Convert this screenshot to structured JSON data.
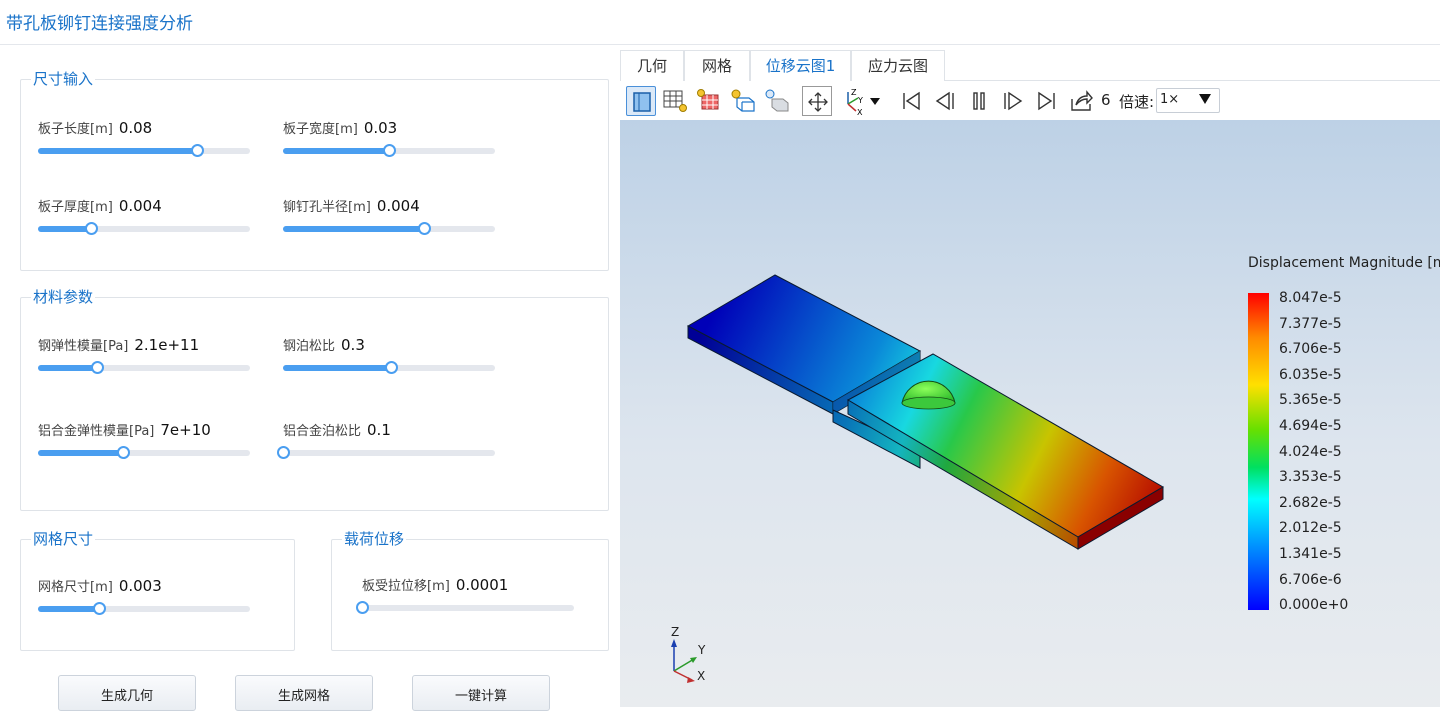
{
  "app": {
    "title": "带孔板铆钉连接强度分析"
  },
  "groups": {
    "size": {
      "title": "尺寸输入",
      "params": [
        {
          "label": "板子长度[m]",
          "value": "0.08",
          "fraction": 0.75
        },
        {
          "label": "板子宽度[m]",
          "value": "0.03",
          "fraction": 0.5
        },
        {
          "label": "板子厚度[m]",
          "value": "0.004",
          "fraction": 0.25
        },
        {
          "label": "铆钉孔半径[m]",
          "value": "0.004",
          "fraction": 0.667
        }
      ]
    },
    "material": {
      "title": "材料参数",
      "params": [
        {
          "label": "钢弹性模量[Pa]",
          "value": "2.1e+11",
          "fraction": 0.28
        },
        {
          "label": "钢泊松比",
          "value": "0.3",
          "fraction": 0.51
        },
        {
          "label": "铝合金弹性模量[Pa]",
          "value": "7e+10",
          "fraction": 0.4
        },
        {
          "label": "铝合金泊松比",
          "value": "0.1",
          "fraction": 0.0
        }
      ]
    },
    "mesh": {
      "title": "网格尺寸",
      "params": [
        {
          "label": "网格尺寸[m]",
          "value": "0.003",
          "fraction": 0.29
        }
      ]
    },
    "load": {
      "title": "载荷位移",
      "params": [
        {
          "label": "板受拉位移[m]",
          "value": "0.0001",
          "fraction": 0.0
        }
      ]
    }
  },
  "buttons": {
    "geometry": "生成几何",
    "mesh": "生成网格",
    "compute": "一键计算"
  },
  "tabs": [
    {
      "label": "几何"
    },
    {
      "label": "网格"
    },
    {
      "label": "位移云图1",
      "active": true
    },
    {
      "label": "应力云图"
    }
  ],
  "toolbar": {
    "frame": "6",
    "speed_label": "倍速:",
    "speed_value": "1×",
    "icons": [
      "front-view-icon",
      "wireframe-icon",
      "surface-icon",
      "light-wireframe-icon",
      "light-surface-icon",
      "fit-view-icon",
      "axes-icon",
      "first-frame-icon",
      "prev-frame-icon",
      "pause-icon",
      "next-frame-icon",
      "last-frame-icon",
      "export-icon"
    ]
  },
  "legend": {
    "title": "Displacement Magnitude [m]",
    "ticks": [
      "8.047e-5",
      "7.377e-5",
      "6.706e-5",
      "6.035e-5",
      "5.365e-5",
      "4.694e-5",
      "4.024e-5",
      "3.353e-5",
      "2.682e-5",
      "2.012e-5",
      "1.341e-5",
      "6.706e-6",
      "0.000e+0"
    ],
    "colors": {
      "max": "#ff0000",
      "mid": "#00ff60",
      "min": "#0000ff"
    }
  },
  "triad": {
    "z": "Z",
    "y": "Y",
    "x": "X"
  }
}
